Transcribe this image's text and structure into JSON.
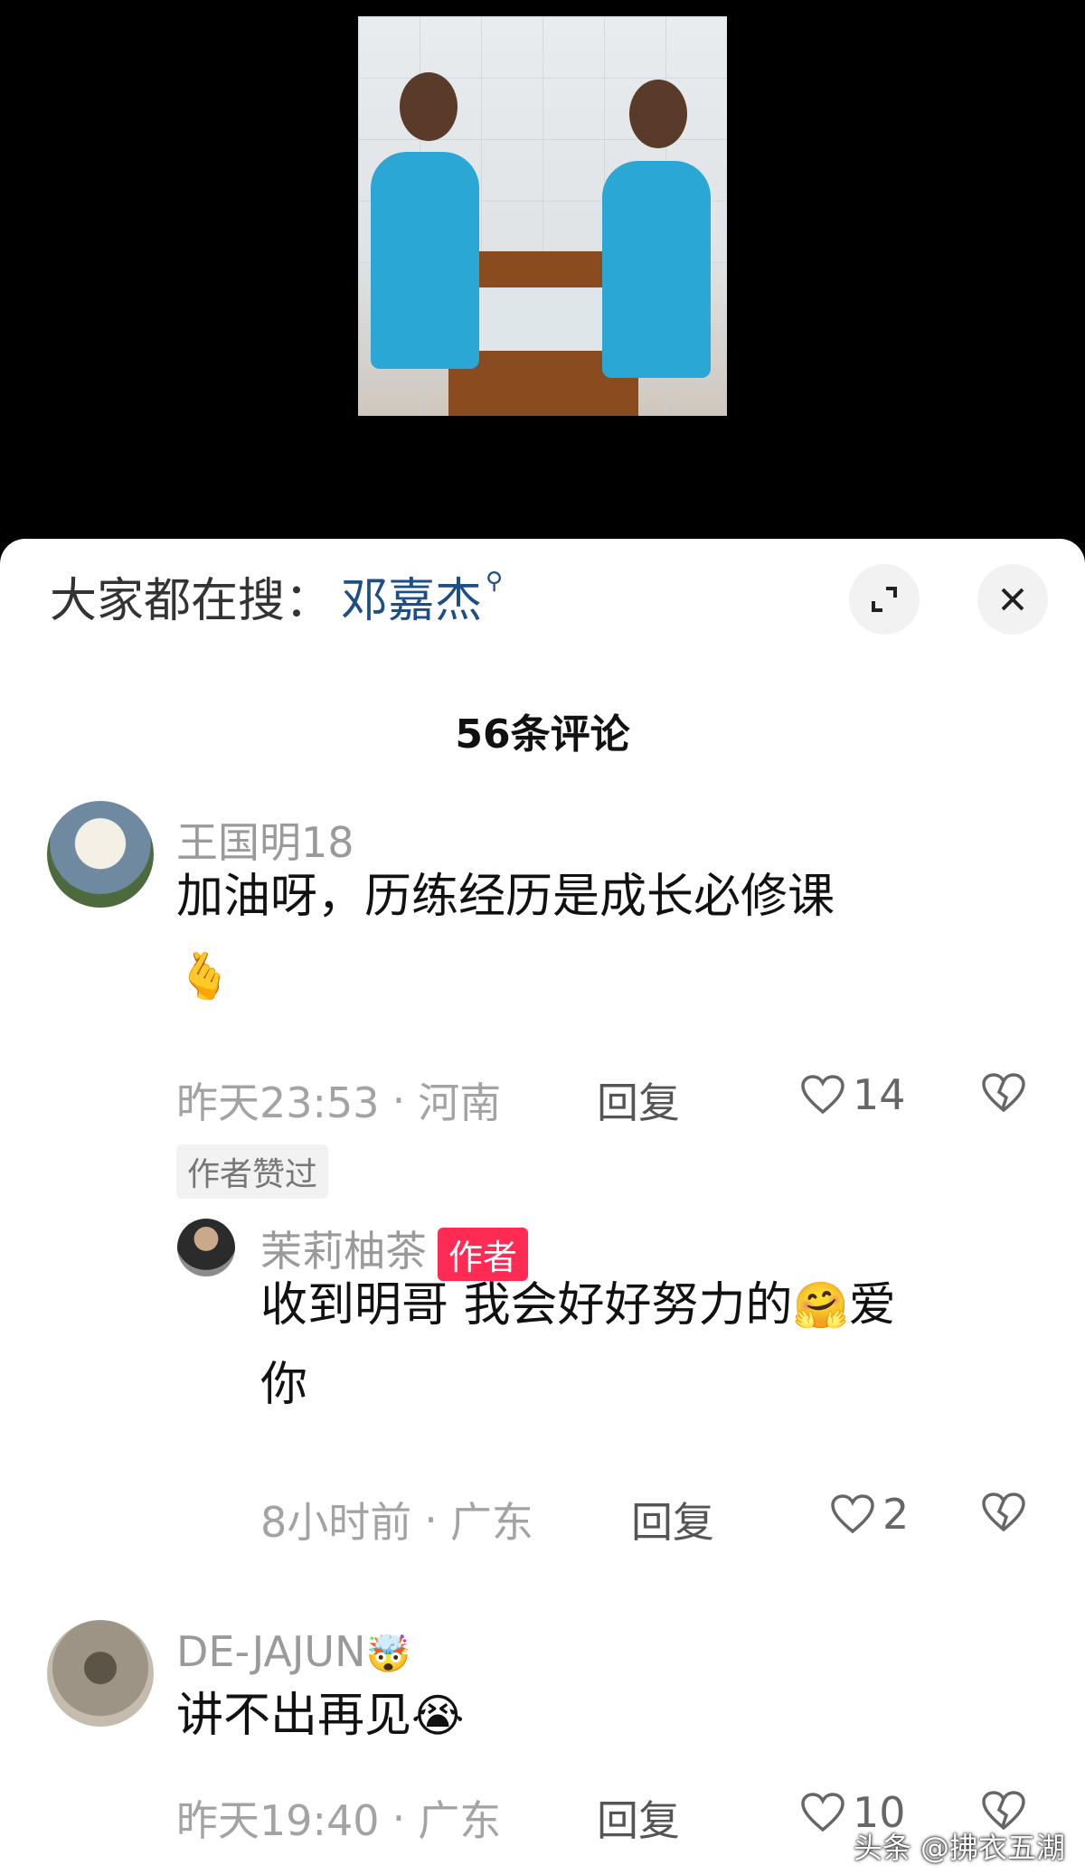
{
  "search": {
    "prefix": "大家都在搜：",
    "term": "邓嘉杰"
  },
  "comments_count": "56条评论",
  "comments": [
    {
      "user": "王国明18",
      "text": "加油呀，历练经历是成长必修课",
      "emoji": "🫰",
      "time": "昨天23:53",
      "location": "河南",
      "reply_label": "回复",
      "likes": "14",
      "author_liked": "作者赞过"
    },
    {
      "user": "茉莉柚茶",
      "author_tag": "作者",
      "text_line1": "收到明哥 我会好好努力的",
      "emoji": "🤗",
      "text_line1_tail": "爱",
      "text_line2": "你",
      "time": "8小时前",
      "location": "广东",
      "reply_label": "回复",
      "likes": "2"
    },
    {
      "user": "DE-JAJUN",
      "user_emoji": "🤯",
      "text": "讲不出再见",
      "emoji": "😭",
      "time": "昨天19:40",
      "location": "广东",
      "reply_label": "回复",
      "likes": "10"
    }
  ],
  "watermark": "头条 @拂衣五湖",
  "colors": {
    "search_term": "#1d4f86",
    "author_tag": "#fe2c55"
  },
  "icons": [
    "magnifier-icon",
    "expand-icon",
    "close-icon",
    "heart-icon",
    "broken-heart-icon"
  ]
}
